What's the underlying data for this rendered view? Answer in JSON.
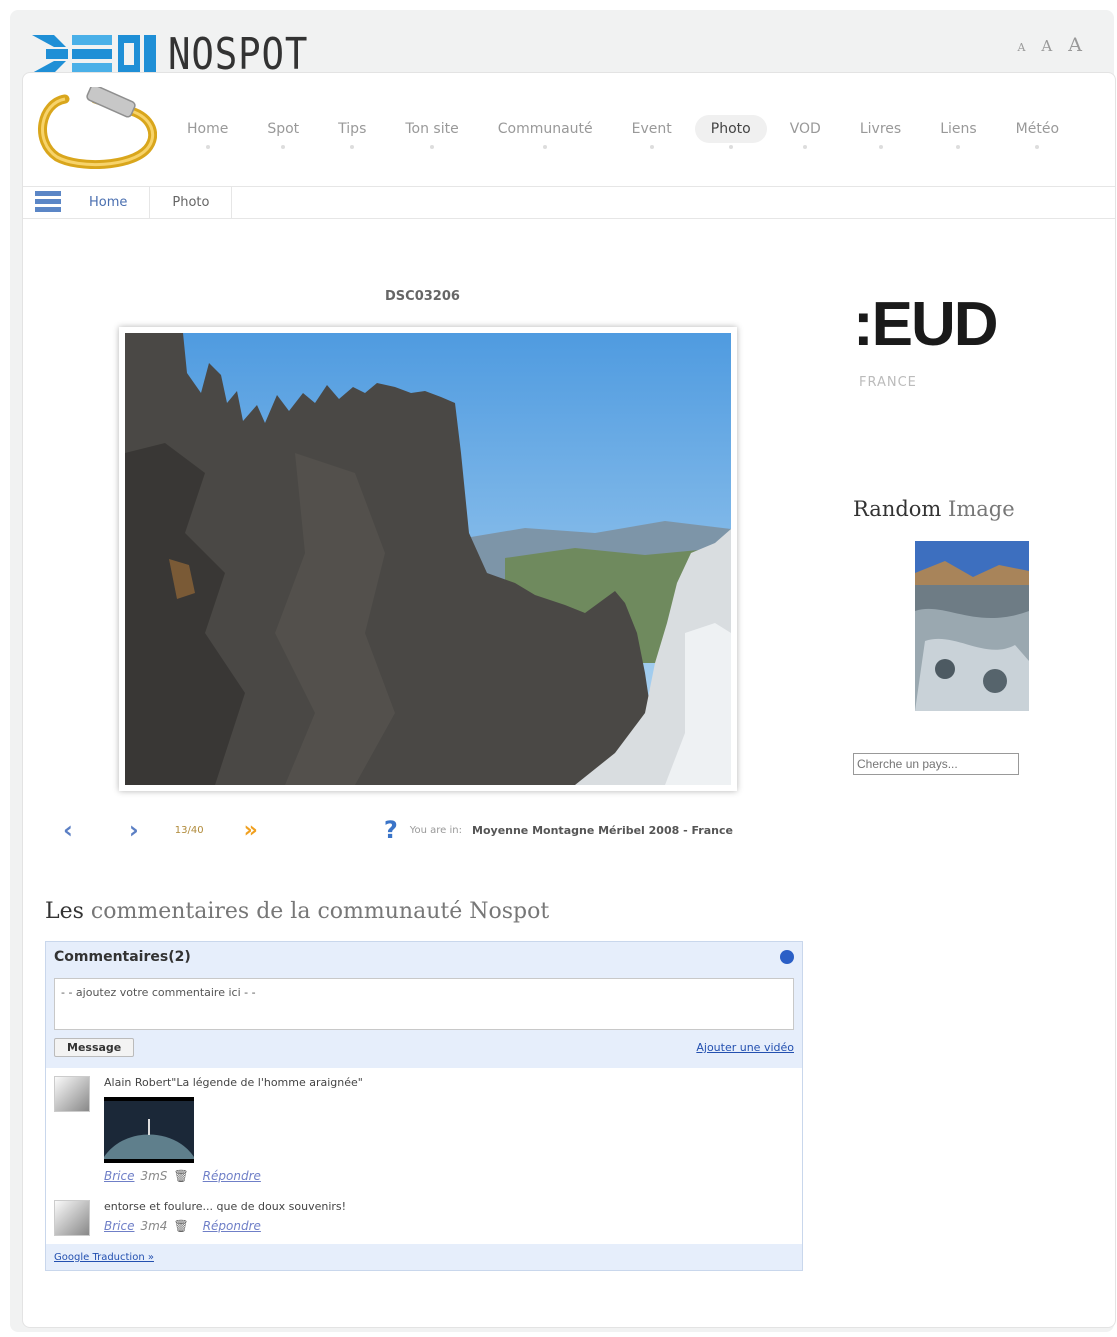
{
  "site": {
    "logo_text": "NOSPOT",
    "font_sizes": [
      "A",
      "A",
      "A"
    ]
  },
  "menu": {
    "items": [
      "Home",
      "Spot",
      "Tips",
      "Ton site",
      "Communauté",
      "Event",
      "Photo",
      "VOD",
      "Livres",
      "Liens",
      "Météo"
    ],
    "active": "Photo"
  },
  "breadcrumb": {
    "home": "Home",
    "current": "Photo"
  },
  "photo": {
    "title": "DSC03206"
  },
  "pager": {
    "prev": "‹",
    "next": "›",
    "count": "13/40",
    "fast_forward": "»",
    "help": "?",
    "you_are_in_label": "You are in:",
    "location": "Moyenne Montagne Méribel 2008 - France"
  },
  "comments_section": {
    "heading_strong": "Les",
    "heading_rest": " commentaires de la communauté Nospot",
    "box_title": "Commentaires(2)",
    "placeholder": "- - ajoutez votre commentaire ici - -",
    "message_button": "Message",
    "add_video_link": "Ajouter une vidéo",
    "google_translate": "Google Traduction »",
    "comments": [
      {
        "text": "Alain Robert\"La légende de l'homme araignée\"",
        "user": "Brice",
        "time": "3mS",
        "reply": "Répondre"
      },
      {
        "text": "entorse et foulure... que de doux souvenirs!",
        "user": "Brice",
        "time": "3m4",
        "reply": "Répondre"
      }
    ]
  },
  "sidebar": {
    "brand_text": ":EUD",
    "brand_sub": "FRANCE",
    "random_strong": "Random",
    "random_rest": " Image",
    "search_placeholder": "Cherche un pays..."
  },
  "colors": {
    "accent_blue": "#4a6fb0",
    "comment_bg": "#e6eefb",
    "fast_forward": "#f0a020"
  }
}
